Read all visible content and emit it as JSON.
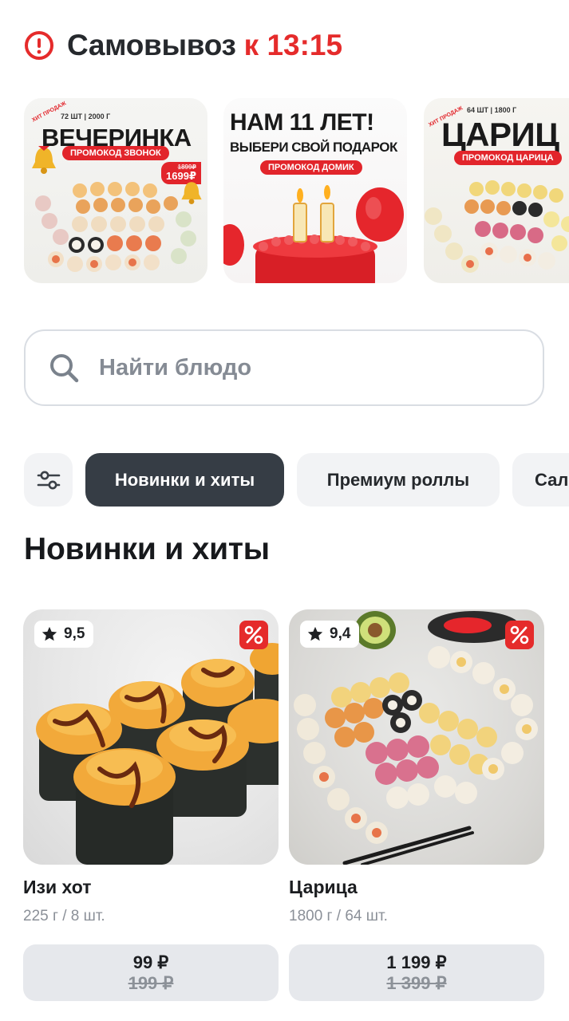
{
  "header": {
    "title": "Самовывоз",
    "time_prefix": "к",
    "time": "13:15",
    "accent_color": "#e52b2b"
  },
  "stories": [
    {
      "meta": "72 ШТ | 2000 Г",
      "headline": "ВЕЧЕРИНКА",
      "promo": "ПРОМОКОД ЗВОНОК",
      "old_price": "1899₽",
      "new_price": "1699₽",
      "tag": "ХИТ ПРОДАЖ"
    },
    {
      "headline": "НАМ 11 ЛЕТ!",
      "subline": "ВЫБЕРИ СВОЙ ПОДАРОК",
      "promo": "ПРОМОКОД ДОМИК",
      "number": "11"
    },
    {
      "meta": "64 ШТ | 1800 Г",
      "headline": "ЦАРИЦ",
      "promo": "ПРОМОКОД ЦАРИЦА",
      "tag": "ХИТ ПРОДАЖ"
    }
  ],
  "search": {
    "placeholder": "Найти блюдо",
    "icon": "search-icon"
  },
  "categories": {
    "filter_icon": "sliders-icon",
    "items": [
      "Новинки и хиты",
      "Премиум роллы",
      "Сал"
    ],
    "active_index": 0
  },
  "section": {
    "title": "Новинки и хиты"
  },
  "products": [
    {
      "rating": "9,5",
      "name": "Изи хот",
      "weight": "225 г / 8 шт.",
      "price": "99 ₽",
      "old_price": "199 ₽",
      "badge": "percent-icon"
    },
    {
      "rating": "9,4",
      "name": "Царица",
      "weight": "1800 г / 64 шт.",
      "price": "1 199 ₽",
      "old_price": "1 399 ₽",
      "badge": "percent-icon"
    }
  ]
}
